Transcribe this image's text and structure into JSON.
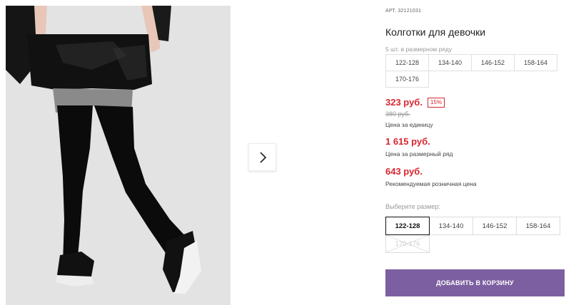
{
  "product": {
    "article_label": "АРТ.",
    "article_number": "32121031",
    "title": "Колготки для девочки",
    "pack_caption": "5 шт. в размерном ряду",
    "pack_sizes": [
      "122-128",
      "134-140",
      "146-152",
      "158-164",
      "170-176"
    ]
  },
  "prices": {
    "unit_price": "323 руб.",
    "discount": "15%",
    "old_price": "380 руб.",
    "unit_caption": "Цена за единицу",
    "series_price": "1 615 руб.",
    "series_caption": "Цена за размерный ряд",
    "retail_price": "643 руб.",
    "retail_caption": "Рекомендуемая розничная цена"
  },
  "size_picker": {
    "label": "Выберите размер:",
    "sizes": [
      {
        "label": "122-128",
        "state": "selected"
      },
      {
        "label": "134-140",
        "state": "available"
      },
      {
        "label": "146-152",
        "state": "available"
      },
      {
        "label": "158-164",
        "state": "available"
      },
      {
        "label": "170-176",
        "state": "unavailable"
      }
    ]
  },
  "actions": {
    "add_to_cart": "ДОБАВИТЬ В КОРЗИНУ"
  },
  "gallery": {
    "next_icon": "chevron-right-icon"
  },
  "colors": {
    "price_red": "#d6262f",
    "button_purple": "#7c5fa0",
    "selected_border": "#111111"
  }
}
